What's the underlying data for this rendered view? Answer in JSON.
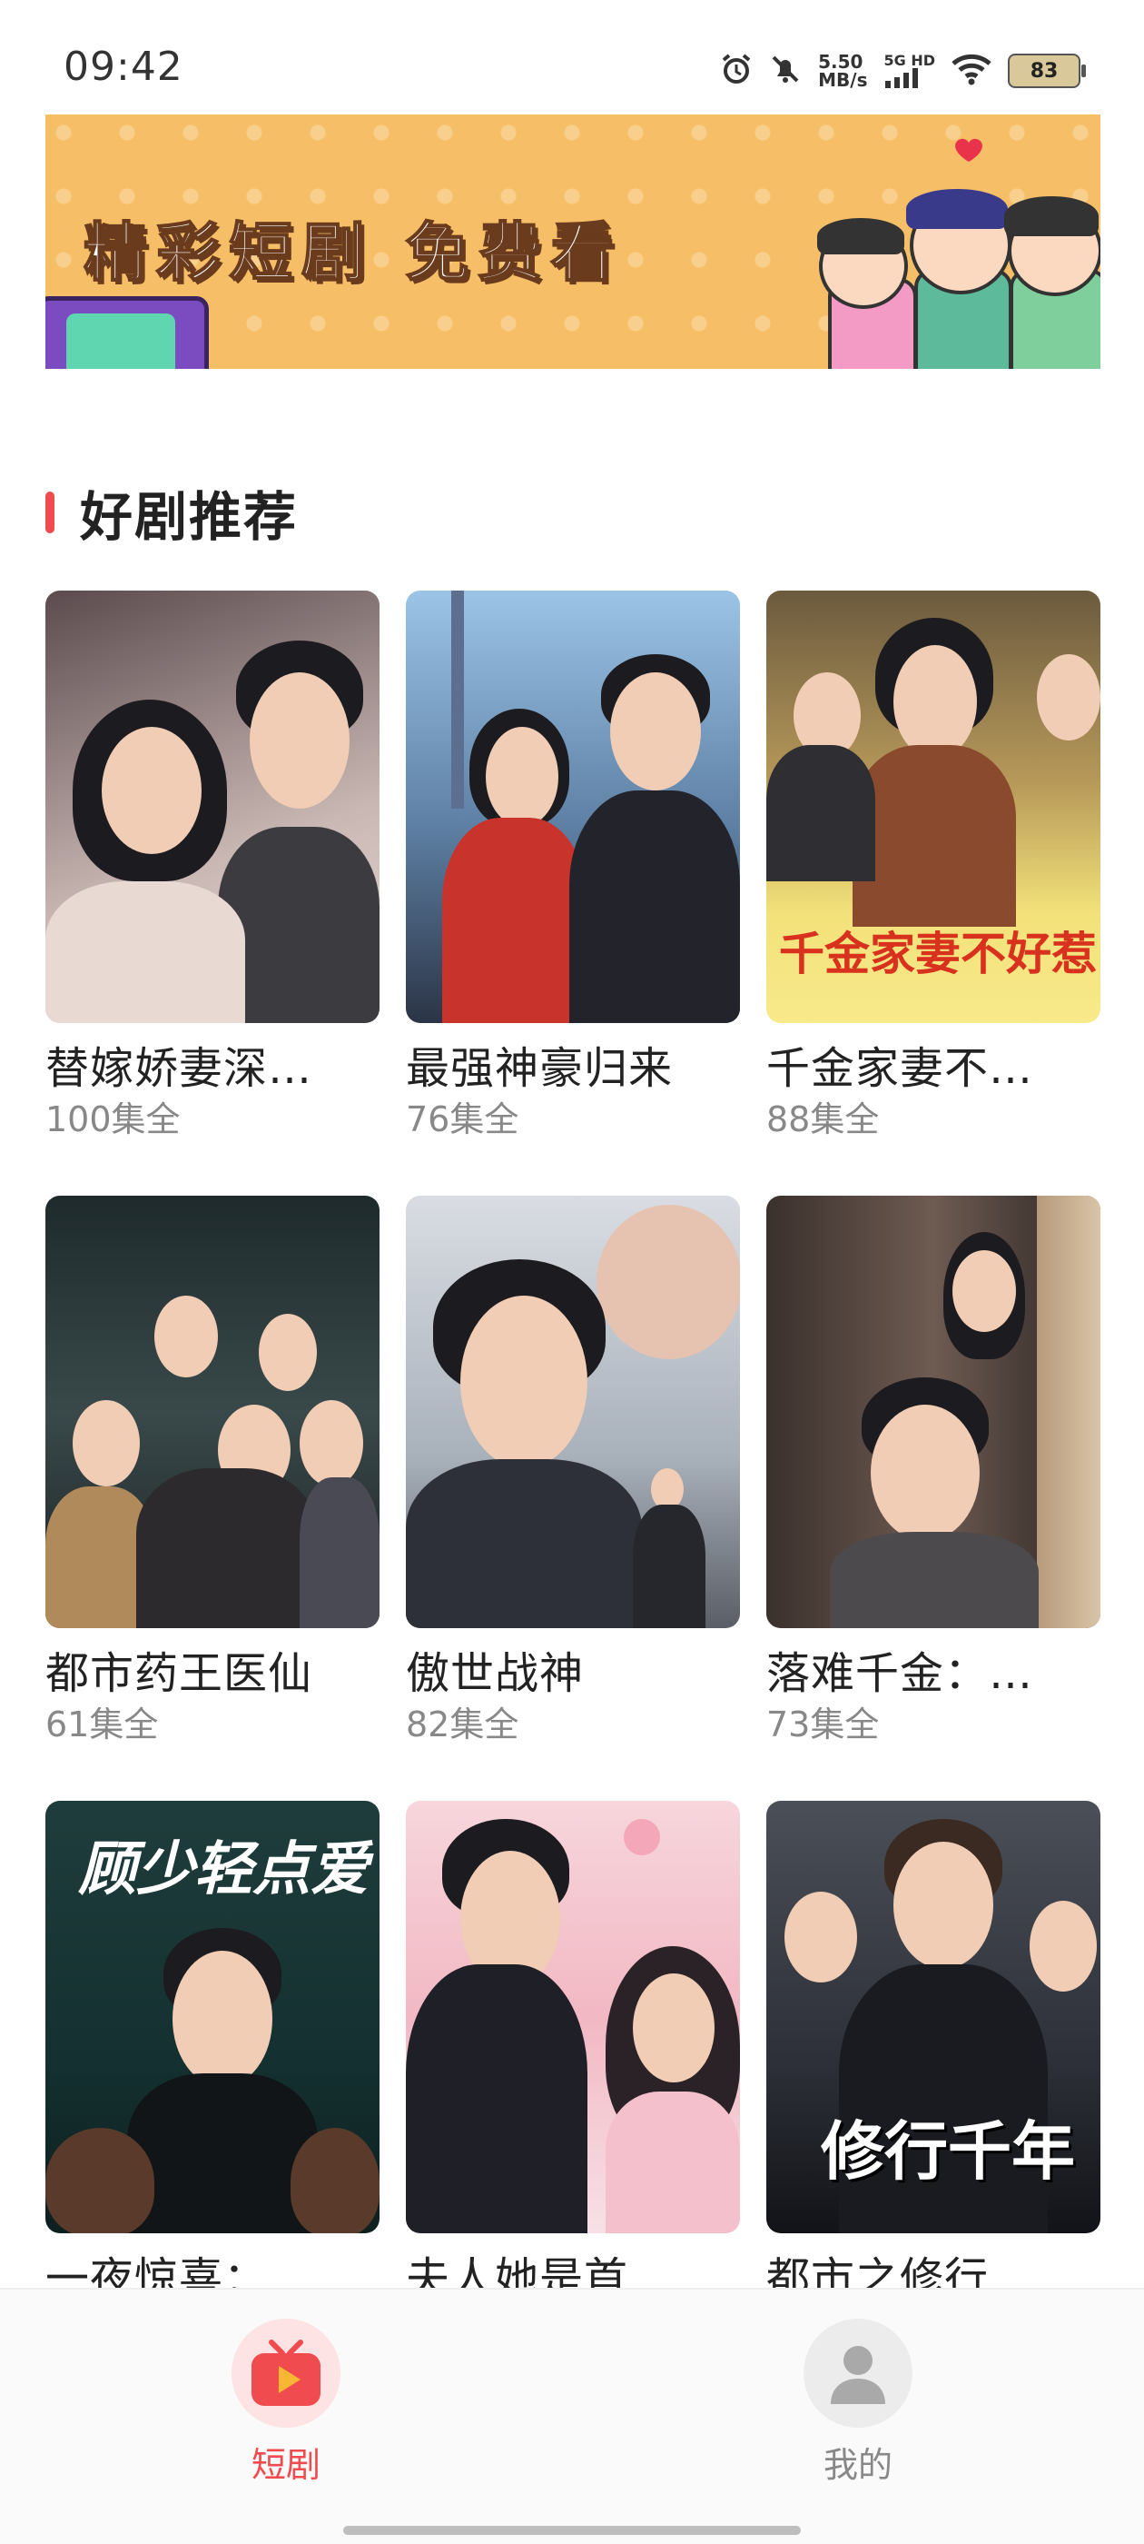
{
  "status_bar": {
    "time": "09:42",
    "speed_value": "5.50",
    "speed_unit": "MB/s",
    "network_top": "5G HD",
    "battery": "83"
  },
  "banner": {
    "title": "精彩短剧 免费看"
  },
  "section": {
    "title": "好剧推荐",
    "accent_color": "#f04b4e"
  },
  "dramas": [
    {
      "title": "替嫁娇妻深…",
      "episodes": "100集全"
    },
    {
      "title": "最强神豪归来",
      "episodes": "76集全"
    },
    {
      "title": "千金家妻不…",
      "episodes": "88集全",
      "poster_text": "千金家妻不好惹"
    },
    {
      "title": "都市药王医仙",
      "episodes": "61集全"
    },
    {
      "title": "傲世战神",
      "episodes": "82集全"
    },
    {
      "title": "落难千金：…",
      "episodes": "73集全"
    },
    {
      "title": "一夜惊喜：…",
      "episodes": "",
      "poster_text": "顾少轻点爱"
    },
    {
      "title": "夫人她是首…",
      "episodes": ""
    },
    {
      "title": "都市之修行…",
      "episodes": "",
      "poster_text": "修行千年"
    }
  ],
  "nav": {
    "drama_label": "短剧",
    "mine_label": "我的",
    "active_color": "#f04b4e",
    "inactive_color": "#888888"
  }
}
